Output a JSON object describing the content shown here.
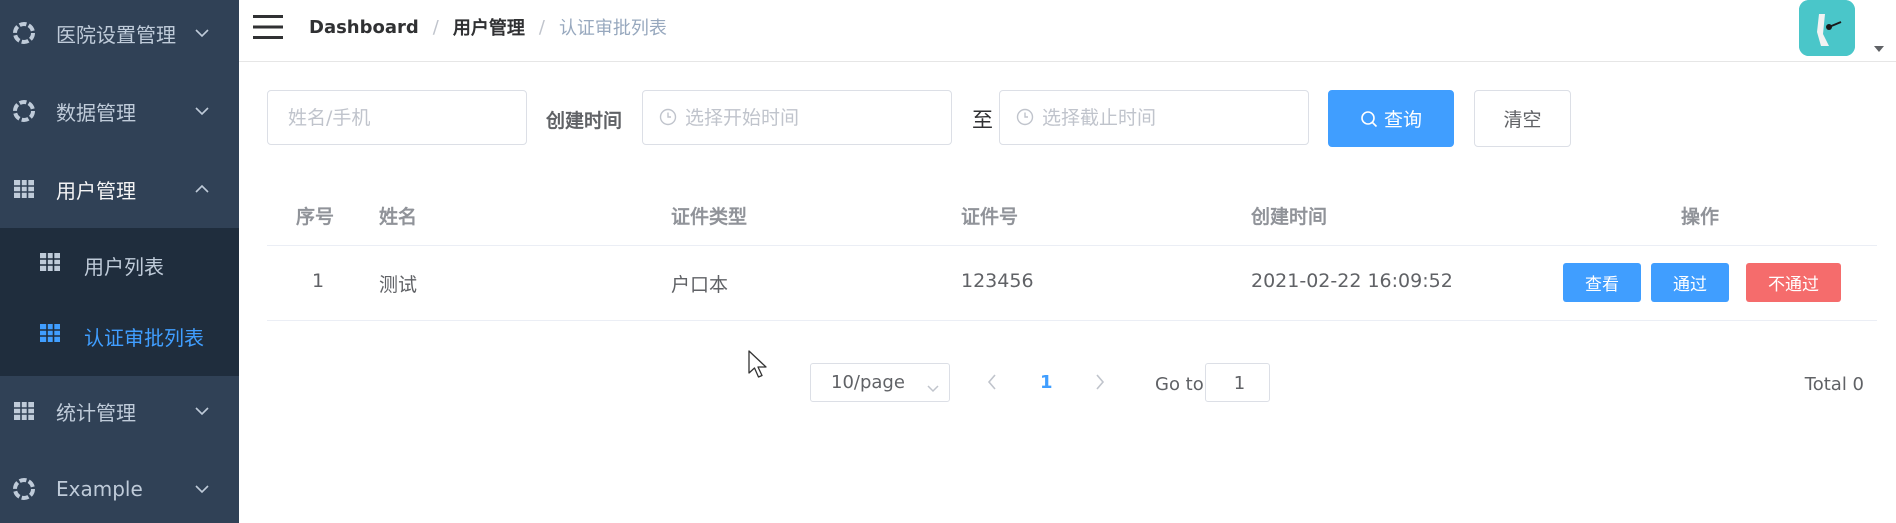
{
  "sidebar": {
    "items": [
      {
        "label": "医院设置管理",
        "icon": "gear-circle-icon"
      },
      {
        "label": "数据管理",
        "icon": "gear-circle-icon"
      },
      {
        "label": "用户管理",
        "icon": "table-icon"
      },
      {
        "label": "统计管理",
        "icon": "table-icon"
      },
      {
        "label": "Example",
        "icon": "gear-circle-icon"
      }
    ],
    "subitems": [
      {
        "label": "用户列表",
        "icon": "table-icon"
      },
      {
        "label": "认证审批列表",
        "icon": "table-icon"
      }
    ]
  },
  "navbar": {
    "breadcrumb": [
      "Dashboard",
      "用户管理",
      "认证审批列表"
    ],
    "separator": "/"
  },
  "filters": {
    "name_placeholder": "姓名/手机",
    "created_label": "创建时间",
    "start_placeholder": "选择开始时间",
    "range_sep": "至",
    "end_placeholder": "选择截止时间",
    "search_label": "查询",
    "clear_label": "清空"
  },
  "table": {
    "headers": [
      "序号",
      "姓名",
      "证件类型",
      "证件号",
      "创建时间",
      "操作"
    ],
    "rows": [
      {
        "index": "1",
        "name": "测试",
        "cert_type": "户口本",
        "cert_no": "123456",
        "created": "2021-02-22 16:09:52"
      }
    ],
    "actions": {
      "view": "查看",
      "approve": "通过",
      "reject": "不通过"
    }
  },
  "pagination": {
    "page_size": "10/page",
    "current_page": "1",
    "goto_label": "Go to",
    "goto_value": "1",
    "total": "Total 0"
  },
  "colors": {
    "sidebar_bg": "#304156",
    "submenu_bg": "#1f2d3d",
    "accent": "#409eff",
    "danger": "#f56c6c"
  }
}
